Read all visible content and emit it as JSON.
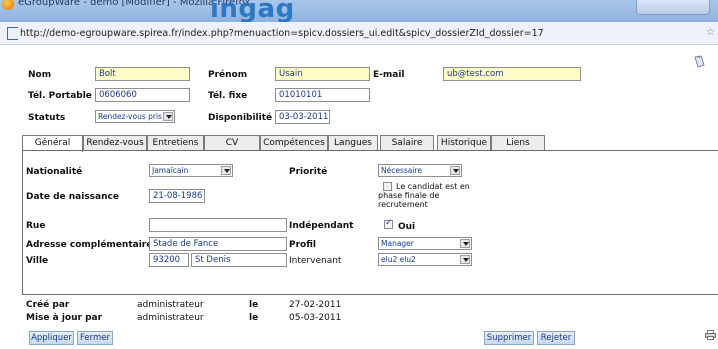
{
  "window": {
    "title": "eGroupWare - demo [Modifier] - Mozilla Firefox",
    "overlay_title": "ingag"
  },
  "url": "http://demo-egroupware.spirea.fr/index.php?menuaction=spicv.dossiers_ui.edit&spicv_dossierZId_dossier=17",
  "header": {
    "nom_label": "Nom",
    "nom_value": "Bolt",
    "prenom_label": "Prénom",
    "prenom_value": "Usain",
    "email_label": "E-mail",
    "email_value": "ub@test.com",
    "tel_portable_label": "Tél. Portable",
    "tel_portable_value": "0606060",
    "tel_fixe_label": "Tél. fixe",
    "tel_fixe_value": "01010101",
    "statut_label": "Statuts",
    "statut_value": "Rendez-vous pris",
    "dispo_label": "Disponibilité",
    "dispo_value": "03-03-2011"
  },
  "tabs": [
    "Général",
    "Rendez-vous",
    "Entretiens",
    "CV",
    "Compétences",
    "Langues",
    "Salaire",
    "Historique",
    "Liens"
  ],
  "general": {
    "nationalite_label": "Nationalité",
    "nationalite_value": "Jamaïcain",
    "priorite_label": "Priorité",
    "priorite_value": "Nécessaire",
    "naissance_label": "Date de naissance",
    "naissance_value": "21-08-1986",
    "finale_text": "Le candidat est en phase finale de recrutement",
    "rue_label": "Rue",
    "rue_value": "",
    "independant_label": "Indépendant",
    "independant_value": "Oui",
    "independant_checked": true,
    "adresse_label": "Adresse complémentaire",
    "adresse_value": "Stade de Fance",
    "profil_label": "Profil",
    "profil_value": "Manager",
    "ville_label": "Ville",
    "cp_value": "93200",
    "ville_value": "St Denis",
    "intervenant_label": "Intervenant",
    "intervenant_value": "elu2 elu2"
  },
  "footer": {
    "cree_label": "Créé par",
    "cree_by": "administrateur",
    "le1": "le",
    "cree_date": "27-02-2011",
    "maj_label": "Mise à jour par",
    "maj_by": "administrateur",
    "le2": "le",
    "maj_date": "05-03-2011"
  },
  "buttons": {
    "appliquer": "Appliquer",
    "fermer": "Fermer",
    "supprimer": "Supprimer",
    "rejeter": "Rejeter"
  },
  "colors": {
    "required_field": "#fffdc6",
    "tab_border": "#7b7b7b",
    "button_gradient_top": "#e6eff9",
    "overlay_title": "#2d78c4"
  }
}
